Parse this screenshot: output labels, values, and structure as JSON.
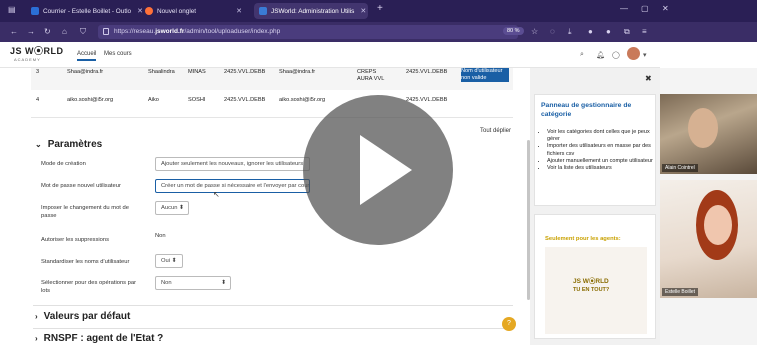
{
  "browser": {
    "tabs": [
      {
        "label": "Courrier - Estelle Boillet - Outlo",
        "icon_color": "#2b6fd6"
      },
      {
        "label": "Nouvel onglet",
        "icon_color": "#ff7139"
      },
      {
        "label": "JSWorld: Administration Utilis",
        "icon_color": "#3a7bd5"
      }
    ],
    "new_tab": "+",
    "url_prefix": "https://reseau.",
    "url_domain": "jsworld.fr",
    "url_path": "/admin/tool/uploaduser/index.php",
    "zoom": "80 %"
  },
  "header": {
    "logo_main": "JS W⦿RLD",
    "logo_sub": "ACADEMY",
    "nav": [
      "Accueil",
      "Mes cours"
    ]
  },
  "table": {
    "rows": [
      {
        "num": "3",
        "email": "Shaa@indra.fr",
        "first": "Shaalindra",
        "last": "MINAS",
        "code": "2425.VVL.DEBB",
        "email2": "Shaa@indra.fr",
        "org": "CREPS AURA VVL",
        "code2": "2425.VVL.DEBB",
        "status": "Nom d'utilisateur non valide"
      },
      {
        "num": "4",
        "email": "aiko.soshi@i5r.org",
        "first": "Aiko",
        "last": "SOSHI",
        "code": "2425.VVL.DEBB",
        "email2": "aiko.soshi@i5r.org",
        "org": "",
        "code2": "2425.VVL.DEBB",
        "status": ""
      }
    ],
    "expand_all": "Tout déplier"
  },
  "params": {
    "title": "Paramètres",
    "fields": [
      {
        "label": "Mode de création",
        "value": "Ajouter seulement les nouveaux, ignorer les utilisateurs"
      },
      {
        "label": "Mot de passe nouvel utilisateur",
        "value": "Créer un mot de passe si nécessaire et l'envoyer par courriel"
      },
      {
        "label": "Imposer le changement du mot de passe",
        "value": "Aucun"
      },
      {
        "label": "Autoriser les suppressions",
        "value": "Non"
      },
      {
        "label": "Standardiser les noms d'utilisateur",
        "value": "Oui"
      },
      {
        "label": "Sélectionner pour des opérations par lots",
        "value": "Non"
      }
    ]
  },
  "sections": [
    "Valeurs par défaut",
    "RNSPF : agent de l'Etat ?"
  ],
  "drawer": {
    "card_title": "Panneau de gestionnaire de catégorie",
    "links": [
      "Voir les catégories dont celles que je peux gérer",
      "Importer des utilisateurs en masse par des fichiers csv",
      "Ajouter manuellement un compte utilisateur",
      "Voir la liste des utilisateurs"
    ],
    "agents_title": "Seulement pour les agents:",
    "brand_line1": "JS W⦿RLD",
    "brand_line2": "TU EN TOUT?"
  },
  "webcams": [
    "Alain Cointrel",
    "Estelle Boillet"
  ],
  "help": "?",
  "colors": {
    "accent": "#1a5fa5",
    "chrome": "#2a1f55",
    "highlight": "#1a5fa5"
  }
}
